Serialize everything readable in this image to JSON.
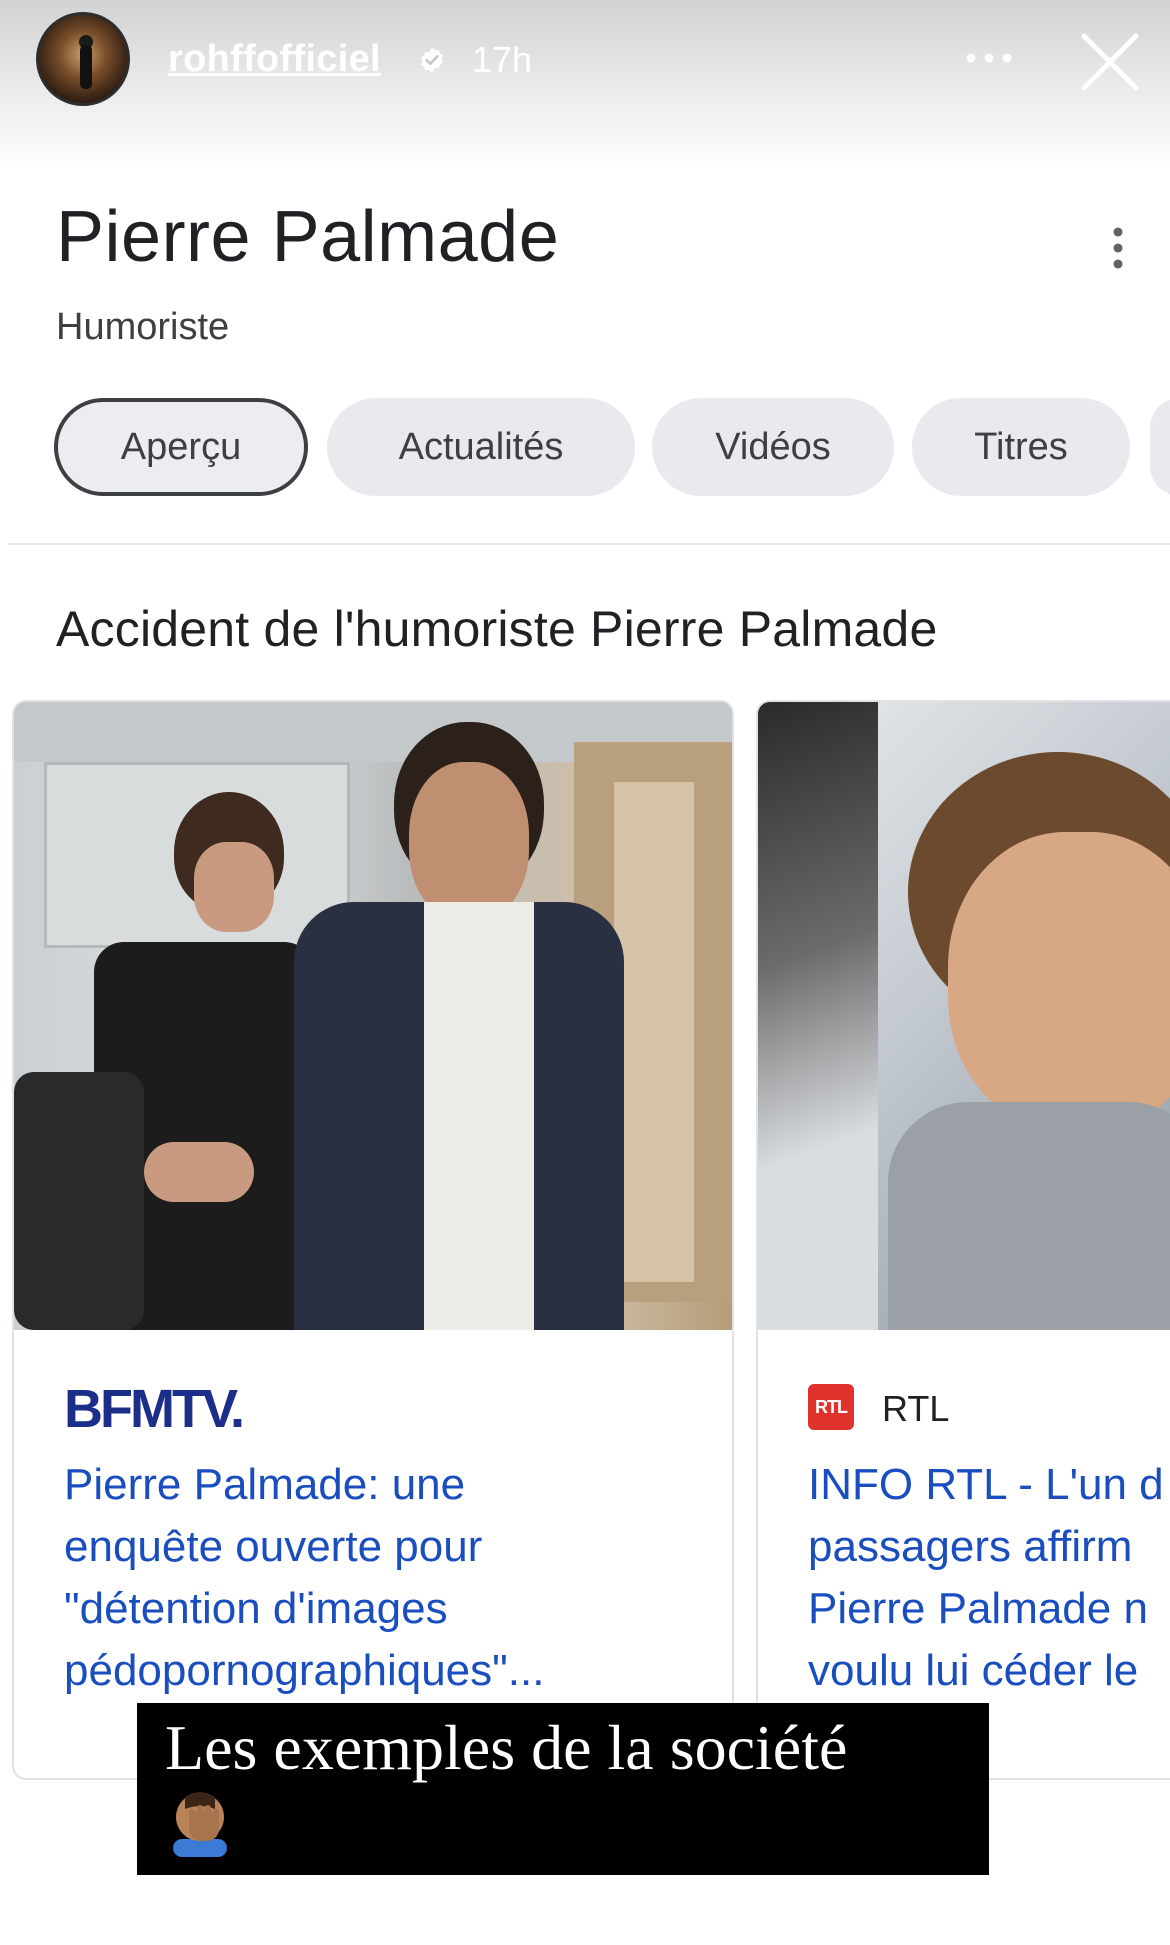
{
  "story": {
    "username": "rohffofficiel",
    "time": "17h",
    "icons": {
      "verified": "verified-badge-icon",
      "more": "more-horizontal-icon",
      "close": "close-icon"
    }
  },
  "panel": {
    "title": "Pierre Palmade",
    "subtitle": "Humoriste",
    "tabs": [
      {
        "label": "Aperçu",
        "active": true
      },
      {
        "label": "Actualités"
      },
      {
        "label": "Vidéos"
      },
      {
        "label": "Titres"
      }
    ],
    "section_title": "Accident de l'humoriste Pierre Palmade"
  },
  "cards": [
    {
      "source": "BFMTV.",
      "headline": "Pierre Palmade: une\nenquête ouverte pour\n\"détention d'images\npédopornographiques\"..."
    },
    {
      "source_badge": "RTL",
      "source": "RTL",
      "headline": "INFO RTL - L'un d\npassagers affirm\nPierre Palmade n\nvoulu lui céder le"
    }
  ],
  "caption": {
    "text": "Les exemples de la société",
    "emoji": "facepalm-icon"
  },
  "colors": {
    "link": "#1a4ebf",
    "bfm": "#1b2e8a",
    "rtl": "#e0322d"
  }
}
